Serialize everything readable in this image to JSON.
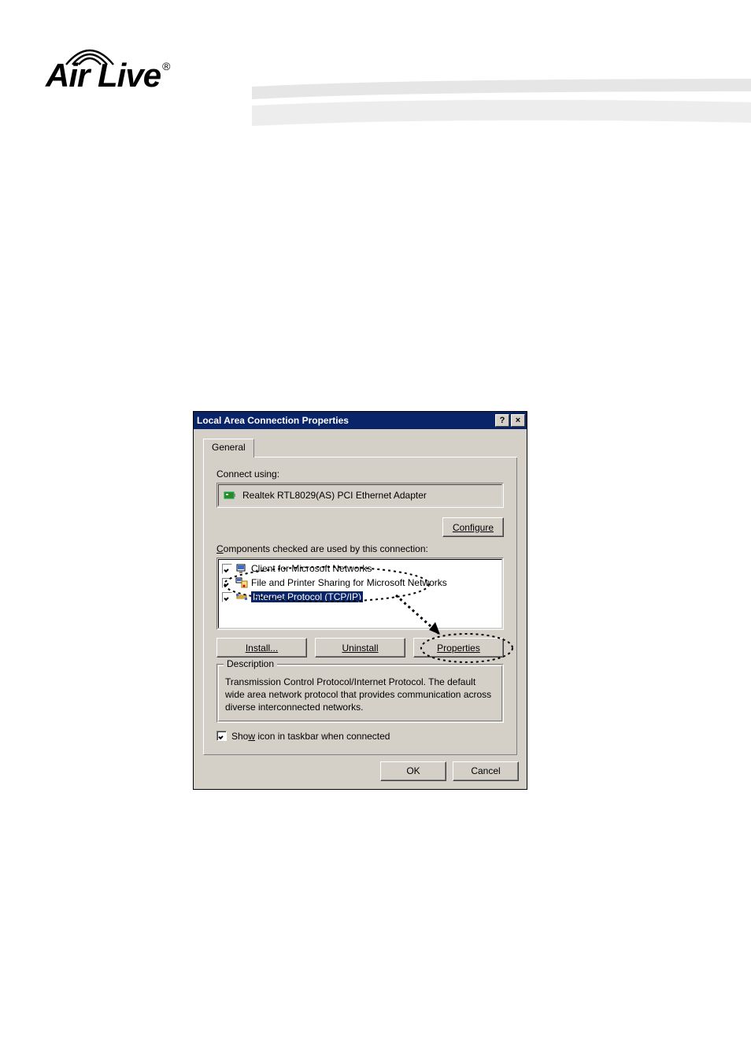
{
  "brand": {
    "name": "Air Live",
    "registered": "®"
  },
  "dialog": {
    "title": "Local Area Connection Properties",
    "help_btn": "?",
    "close_btn": "×",
    "tab": "General",
    "connect_using_label": "Connect using:",
    "adapter_name": "Realtek RTL8029(AS) PCI Ethernet Adapter",
    "configure_btn": "Configure",
    "configure_u": "C",
    "components_label": "Components checked are used by this connection:",
    "components_u": "C",
    "components": [
      {
        "label": "Client for Microsoft Networks",
        "selected": false,
        "icon": "monitor"
      },
      {
        "label": "File and Printer Sharing for Microsoft Networks",
        "selected": false,
        "icon": "share"
      },
      {
        "label": "Internet Protocol (TCP/IP)",
        "selected": true,
        "icon": "net"
      }
    ],
    "install_btn": "Install...",
    "install_u": "I",
    "uninstall_btn": "Uninstall",
    "uninstall_u": "U",
    "properties_btn": "Properties",
    "properties_u": "r",
    "description_legend": "Description",
    "description_text": "Transmission Control Protocol/Internet Protocol. The default wide area network protocol that provides communication across diverse interconnected networks.",
    "show_icon_label": "Show icon in taskbar when connected",
    "show_icon_u": "w",
    "show_icon_checked": true,
    "ok_btn": "OK",
    "cancel_btn": "Cancel"
  }
}
